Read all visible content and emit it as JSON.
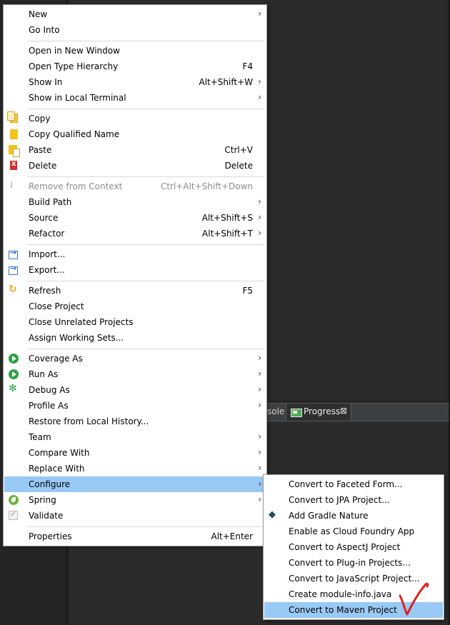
{
  "bottom_tabs": {
    "console_label": "sole",
    "progress_label": "Progress"
  },
  "context_menu": {
    "items": [
      {
        "label": "New",
        "submenu": true
      },
      {
        "label": "Go Into"
      },
      {
        "label": "Open in New Window"
      },
      {
        "label": "Open Type Hierarchy",
        "accel": "F4"
      },
      {
        "label": "Show In",
        "accel": "Alt+Shift+W",
        "submenu": true
      },
      {
        "label": "Show in Local Terminal",
        "submenu": true
      },
      {
        "label": "Copy",
        "icon": "copy-icon"
      },
      {
        "label": "Copy Qualified Name",
        "icon": "copy-qualified-name-icon"
      },
      {
        "label": "Paste",
        "accel": "Ctrl+V",
        "icon": "paste-icon"
      },
      {
        "label": "Delete",
        "accel": "Delete",
        "icon": "delete-icon"
      },
      {
        "label": "Remove from Context",
        "accel": "Ctrl+Alt+Shift+Down",
        "disabled": true,
        "icon": "remove-from-context-icon"
      },
      {
        "label": "Build Path",
        "submenu": true
      },
      {
        "label": "Source",
        "accel": "Alt+Shift+S",
        "submenu": true
      },
      {
        "label": "Refactor",
        "accel": "Alt+Shift+T",
        "submenu": true
      },
      {
        "label": "Import...",
        "icon": "import-icon"
      },
      {
        "label": "Export...",
        "icon": "export-icon"
      },
      {
        "label": "Refresh",
        "accel": "F5",
        "icon": "refresh-icon"
      },
      {
        "label": "Close Project"
      },
      {
        "label": "Close Unrelated Projects"
      },
      {
        "label": "Assign Working Sets..."
      },
      {
        "label": "Coverage As",
        "submenu": true,
        "icon": "coverage-icon"
      },
      {
        "label": "Run As",
        "submenu": true,
        "icon": "run-icon"
      },
      {
        "label": "Debug As",
        "submenu": true,
        "icon": "debug-icon"
      },
      {
        "label": "Profile As",
        "submenu": true
      },
      {
        "label": "Restore from Local History..."
      },
      {
        "label": "Team",
        "submenu": true
      },
      {
        "label": "Compare With",
        "submenu": true
      },
      {
        "label": "Replace With",
        "submenu": true
      },
      {
        "label": "Configure",
        "submenu": true,
        "selected": true
      },
      {
        "label": "Spring",
        "submenu": true,
        "icon": "spring-icon"
      },
      {
        "label": "Validate",
        "icon": "validate-icon"
      },
      {
        "label": "Properties",
        "accel": "Alt+Enter"
      }
    ]
  },
  "configure_submenu": {
    "items": [
      {
        "label": "Convert to Faceted Form..."
      },
      {
        "label": "Convert to JPA Project..."
      },
      {
        "label": "Add Gradle Nature",
        "icon": "gradle-icon"
      },
      {
        "label": "Enable as Cloud Foundry App"
      },
      {
        "label": "Convert to AspectJ Project"
      },
      {
        "label": "Convert to Plug-in Projects..."
      },
      {
        "label": "Convert to JavaScript Project..."
      },
      {
        "label": "Create module-info.java"
      },
      {
        "label": "Convert to Maven Project",
        "selected": true
      }
    ]
  },
  "colors": {
    "menu_bg": "#ffffff",
    "selection_bg": "#99c9f5",
    "ide_bg": "#2b2b2b",
    "annotation_red": "#e02020"
  }
}
